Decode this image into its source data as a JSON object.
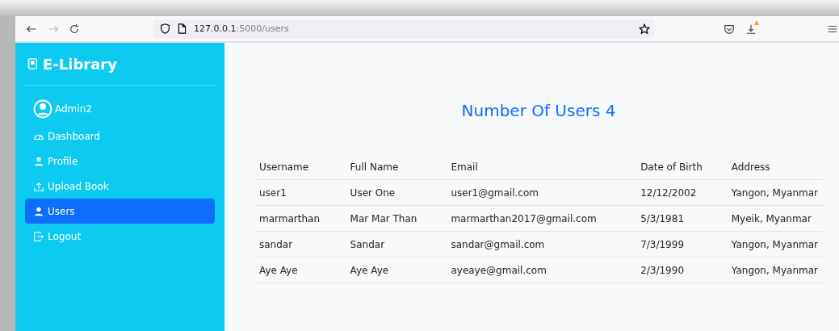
{
  "browser": {
    "url_host": "127.0.0.1",
    "url_path": ":5000/users",
    "download_alert": true
  },
  "sidebar": {
    "brand": "E-Library",
    "user": "Admin2",
    "items": [
      {
        "label": "Dashboard",
        "selected": false
      },
      {
        "label": "Profile",
        "selected": false
      },
      {
        "label": "Upload Book",
        "selected": false
      },
      {
        "label": "Users",
        "selected": true
      },
      {
        "label": "Logout",
        "selected": false
      }
    ]
  },
  "heading": "Number Of Users 4",
  "table": {
    "columns": [
      "Username",
      "Full Name",
      "Email",
      "Date of Birth",
      "Address"
    ],
    "rows": [
      [
        "user1",
        "User One",
        "user1@gmail.com",
        "12/12/2002",
        "Yangon, Myanmar"
      ],
      [
        "marmarthan",
        "Mar Mar Than",
        "marmarthan2017@gmail.com",
        "5/3/1981",
        "Myeik, Myanmar"
      ],
      [
        "sandar",
        "Sandar",
        "sandar@gmail.com",
        "7/3/1999",
        "Yangon, Myanmar"
      ],
      [
        "Aye Aye",
        "Aye Aye",
        "ayeaye@gmail.com",
        "2/3/1990",
        "Yangon, Myanmar"
      ]
    ]
  }
}
